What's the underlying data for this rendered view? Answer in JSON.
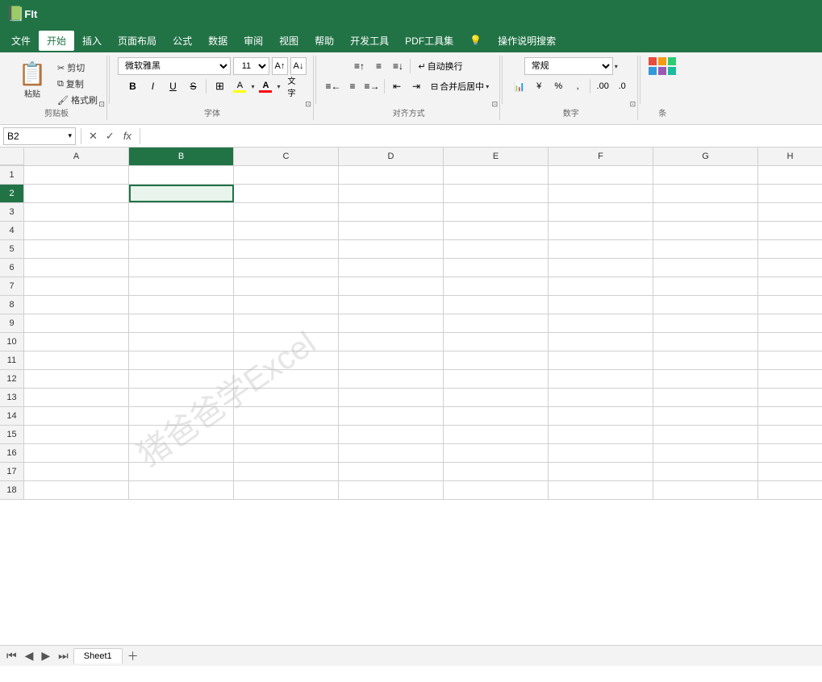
{
  "titlebar": {
    "title": "FIt"
  },
  "menubar": {
    "items": [
      {
        "id": "file",
        "label": "文件"
      },
      {
        "id": "home",
        "label": "开始",
        "active": true
      },
      {
        "id": "insert",
        "label": "插入"
      },
      {
        "id": "pagelayout",
        "label": "页面布局"
      },
      {
        "id": "formula",
        "label": "公式"
      },
      {
        "id": "data",
        "label": "数据"
      },
      {
        "id": "review",
        "label": "审阅"
      },
      {
        "id": "view",
        "label": "视图"
      },
      {
        "id": "help",
        "label": "帮助"
      },
      {
        "id": "devtools",
        "label": "开发工具"
      },
      {
        "id": "pdftool",
        "label": "PDF工具集"
      },
      {
        "id": "lightbulb",
        "label": "💡"
      },
      {
        "id": "search",
        "label": "操作说明搜索"
      }
    ]
  },
  "ribbon": {
    "clipboard": {
      "label": "剪贴板",
      "paste": "粘贴",
      "cut": "剪切",
      "copy": "复制",
      "format_painter": "格式刷"
    },
    "font": {
      "label": "字体",
      "font_name": "微软雅黑",
      "font_size": "11",
      "bold": "B",
      "italic": "I",
      "underline": "U",
      "strikethrough": "S",
      "border_btn": "⊞",
      "fill_color": "A",
      "font_color": "A",
      "increase_size": "A",
      "decrease_size": "A"
    },
    "alignment": {
      "label": "对齐方式",
      "wrap_text": "自动换行",
      "merge_center": "合并后居中"
    },
    "number": {
      "label": "数字",
      "format": "常规"
    },
    "styles": {
      "label": "条"
    }
  },
  "formulabar": {
    "cell_ref": "B2",
    "fx_label": "fx",
    "formula_value": ""
  },
  "columns": [
    "A",
    "B",
    "C",
    "D",
    "E",
    "F",
    "G",
    "H"
  ],
  "rows": [
    1,
    2,
    3,
    4,
    5,
    6,
    7,
    8,
    9,
    10,
    11,
    12,
    13,
    14,
    15,
    16,
    17,
    18
  ],
  "selected_cell": "B2",
  "watermark": "猪爸爸学Excel",
  "sheettabs": {
    "sheets": [
      {
        "label": "Sheet1",
        "active": true
      }
    ]
  }
}
